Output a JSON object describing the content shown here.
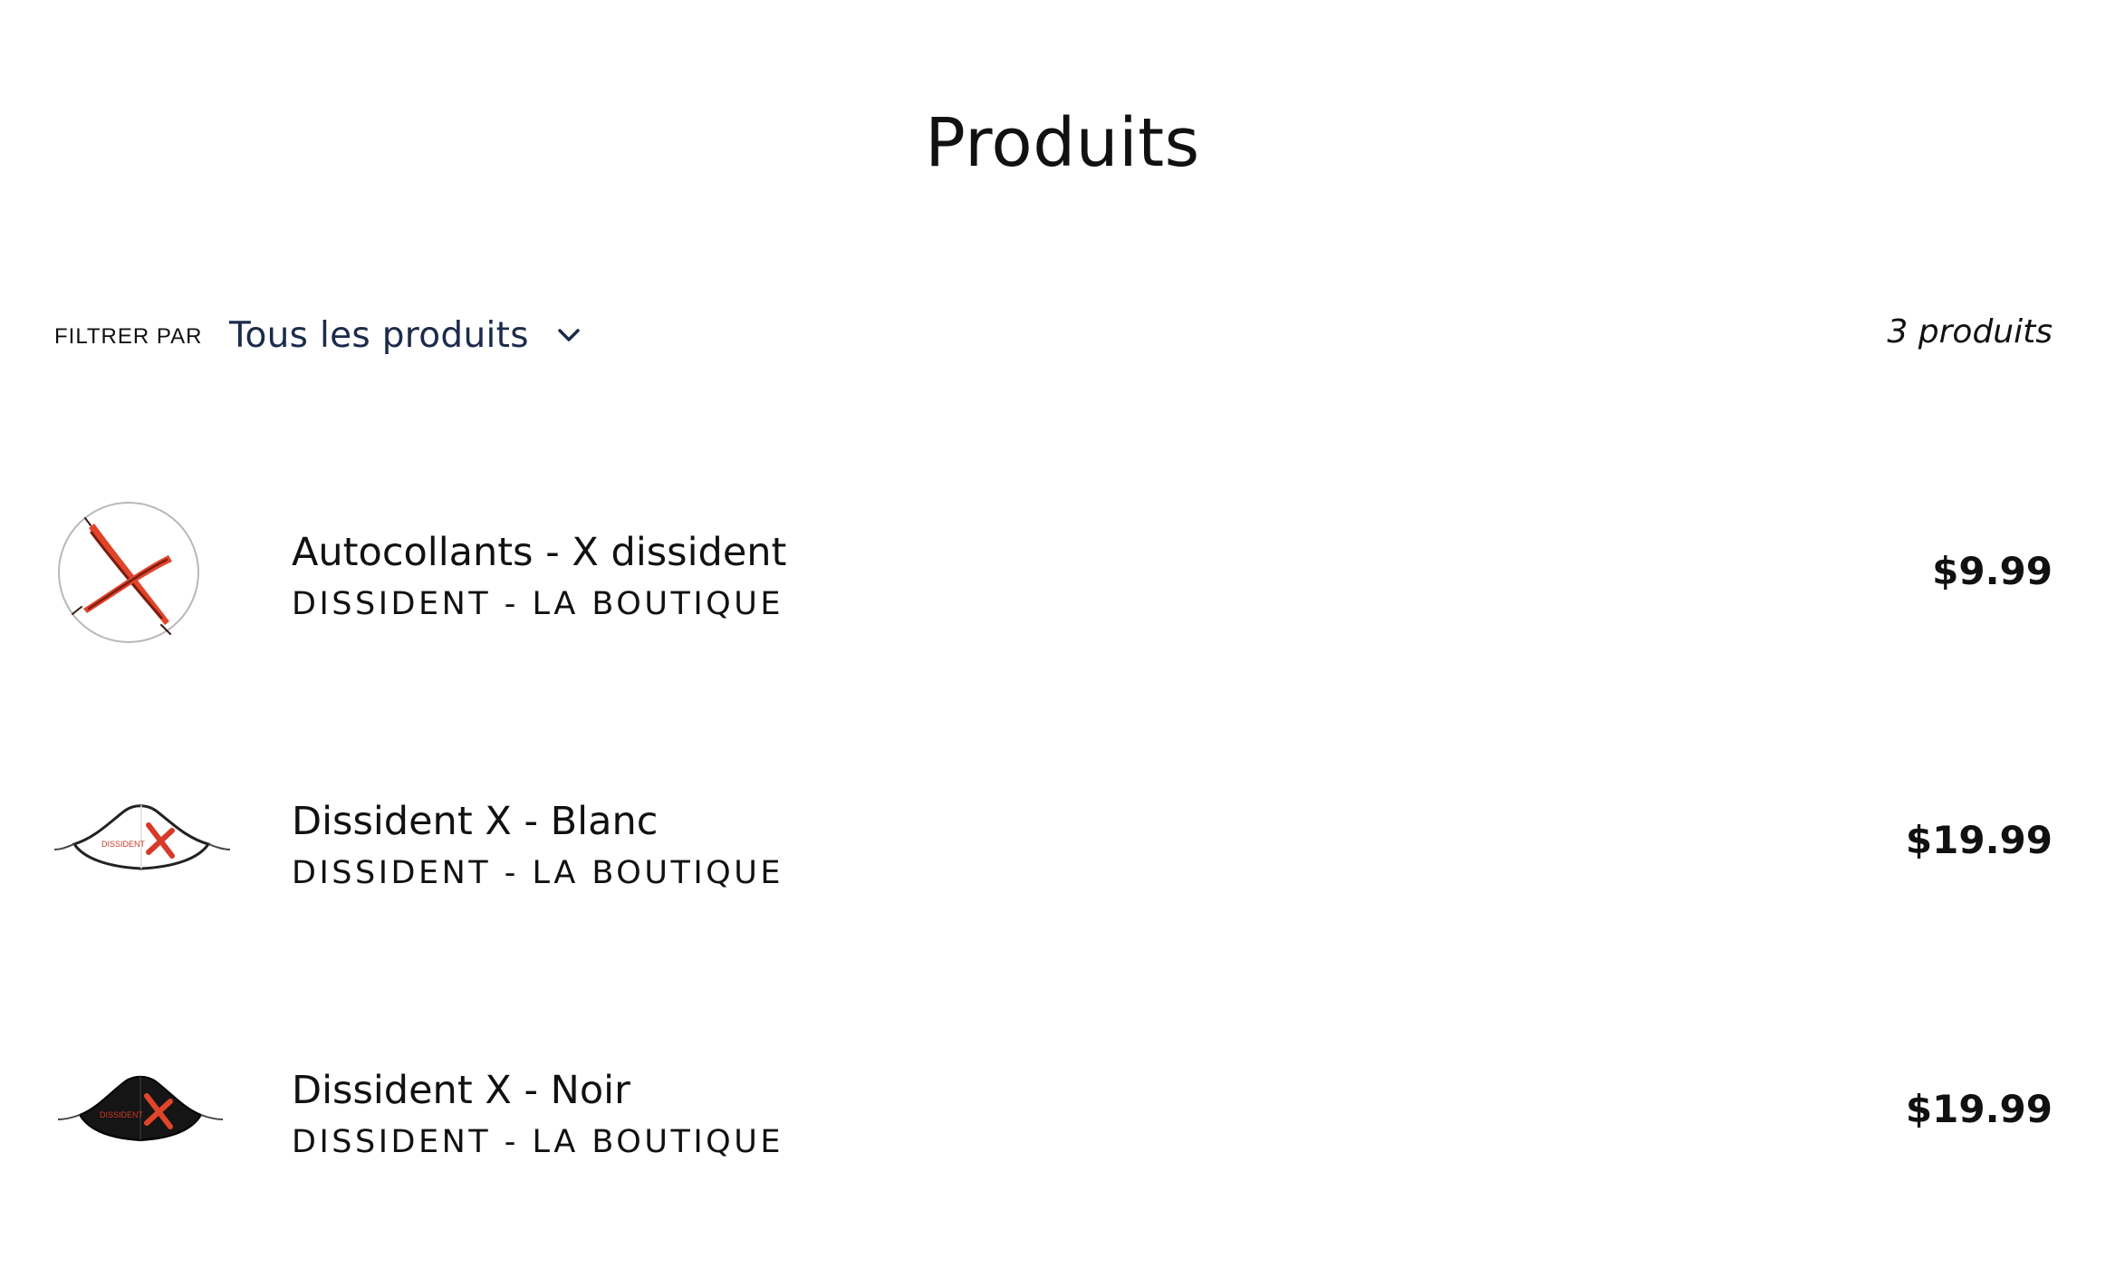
{
  "page": {
    "title": "Produits"
  },
  "filter": {
    "label": "FILTRER PAR",
    "selected": "Tous les produits",
    "icon": "chevron-down-icon"
  },
  "count": "3 produits",
  "colors": {
    "accent_red": "#e0452b",
    "select_text": "#1c2b4a",
    "text": "#111111"
  },
  "products": [
    {
      "name": "Autocollants - X dissident",
      "vendor": "DISSIDENT - LA BOUTIQUE",
      "price": "$9.99",
      "image": "sticker-x-icon"
    },
    {
      "name": "Dissident X - Blanc",
      "vendor": "DISSIDENT - LA BOUTIQUE",
      "price": "$19.99",
      "image": "white-mask-icon",
      "mask_text": "DISSIDENT"
    },
    {
      "name": "Dissident X - Noir",
      "vendor": "DISSIDENT - LA BOUTIQUE",
      "price": "$19.99",
      "image": "black-mask-icon",
      "mask_text": "DISSIDENT"
    }
  ]
}
